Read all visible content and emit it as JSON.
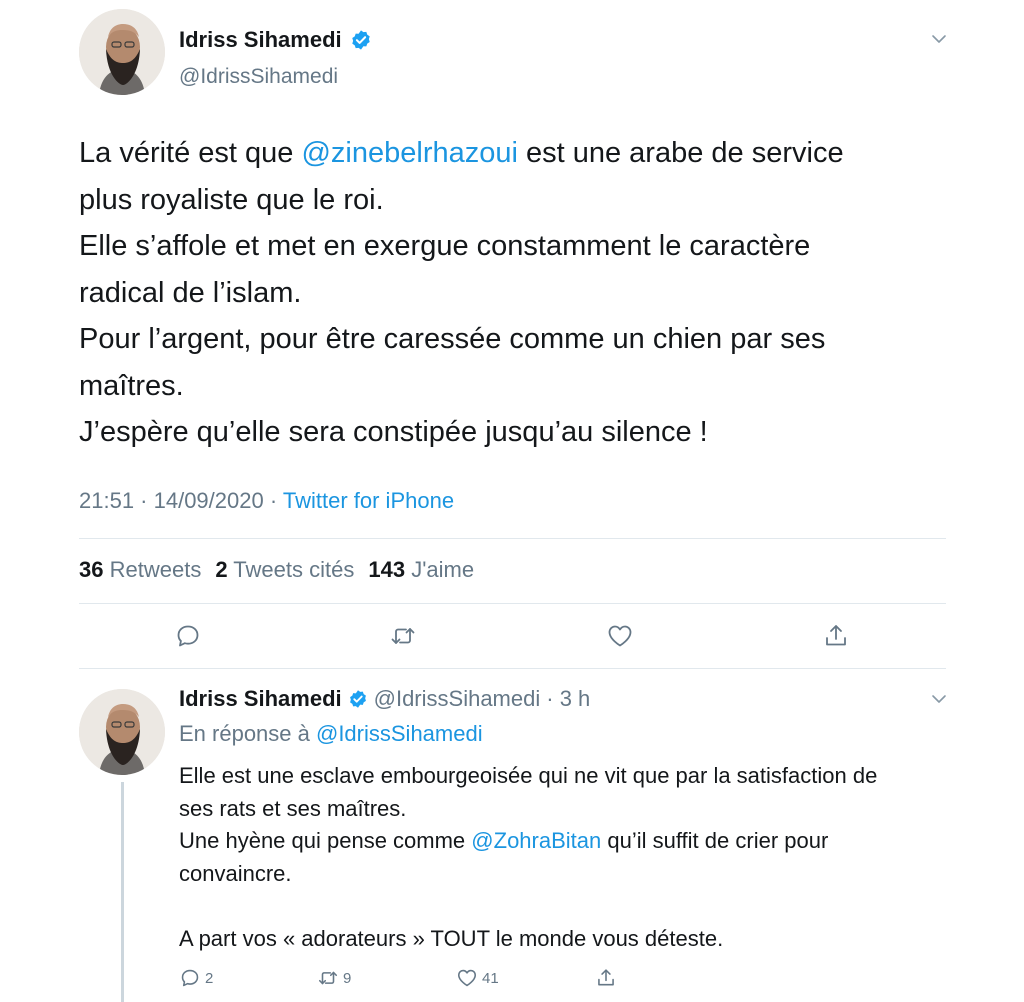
{
  "main_tweet": {
    "author": {
      "display_name": "Idriss Sihamedi",
      "handle": "@IdrissSihamedi",
      "verified": true
    },
    "text_lines": [
      {
        "before": "La vérité est que ",
        "mention": "@zinebelrhazoui",
        "after": " est une arabe de service"
      },
      {
        "text": "plus royaliste que le roi."
      },
      {
        "text": "Elle s’affole et met en exergue constamment le caractère"
      },
      {
        "text": "radical de l’islam."
      },
      {
        "text": "Pour l’argent, pour être caressée comme un chien par ses"
      },
      {
        "text": "maîtres."
      },
      {
        "text": "J’espère qu’elle sera constipée jusqu’au silence !"
      }
    ],
    "timestamp": "21:51 · 14/09/2020 · ",
    "source": "Twitter for iPhone",
    "stats": {
      "retweets_count": "36",
      "retweets_label": "Retweets",
      "quotes_count": "2",
      "quotes_label": "Tweets cités",
      "likes_count": "143",
      "likes_label": "J'aime"
    },
    "actions": [
      "reply-icon",
      "retweet-icon",
      "like-icon",
      "share-icon"
    ]
  },
  "reply_tweet": {
    "author": {
      "display_name": "Idriss Sihamedi",
      "handle": "@IdrissSihamedi",
      "verified": true
    },
    "time_ago": "· 3 h",
    "in_reply_to_label": "En réponse à ",
    "in_reply_to_handle": "@IdrissSihamedi",
    "line1": "Elle est une esclave embourgeoisée qui ne vit que par la satisfaction de",
    "line2": "ses rats et ses maîtres.",
    "line3_before": "Une hyène qui pense comme ",
    "line3_mention": "@ZohraBitan",
    "line3_after": " qu’il suffit de crier pour",
    "line4": "convaincre.",
    "line6": "A part vos « adorateurs » TOUT le monde vous déteste.",
    "actions": {
      "reply_count": "2",
      "retweet_count": "9",
      "like_count": "41"
    }
  },
  "colors": {
    "text": "#14171a",
    "muted": "#657786",
    "link": "#1b95e0",
    "verified": "#1da1f2",
    "divider": "#e1e8ed",
    "thread_line": "#ccd6dd"
  }
}
